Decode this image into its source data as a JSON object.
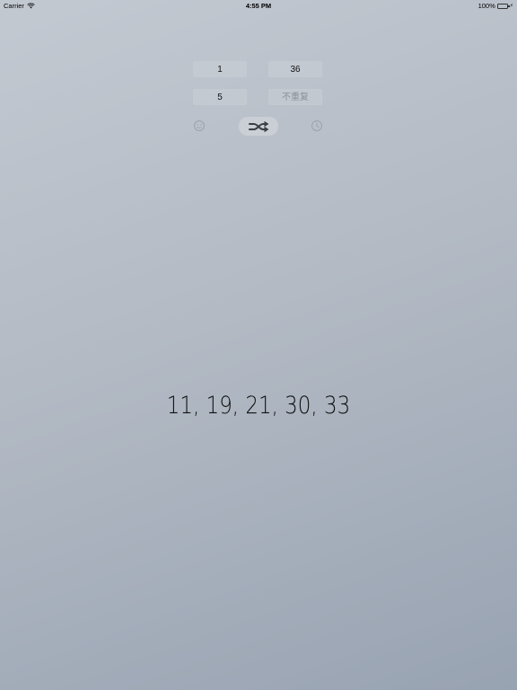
{
  "status_bar": {
    "carrier": "Carrier",
    "time": "4:55 PM",
    "battery": "100%"
  },
  "inputs": {
    "min": "1",
    "max": "36",
    "count": "5",
    "no_repeat_placeholder": "不重复"
  },
  "icons": {
    "left": "smile-icon",
    "center": "shuffle-icon",
    "right": "clock-icon"
  },
  "result": "11, 19, 21, 30, 33",
  "colors": {
    "battery_fill": "#4cd964",
    "background_top": "#c3c9d1",
    "background_bottom": "#98a3b2"
  }
}
